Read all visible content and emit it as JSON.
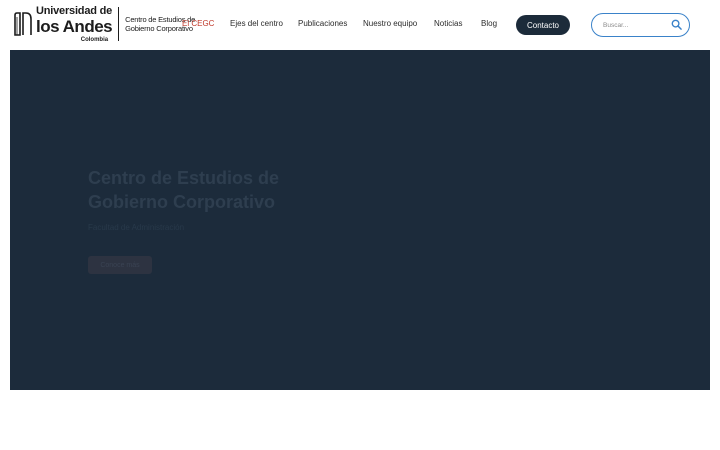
{
  "header": {
    "logo": {
      "line1": "Universidad de",
      "line2": "los Andes",
      "line3": "Colombia",
      "centro_line1": "Centro de Estudios de",
      "centro_line2": "Gobierno Corporativo"
    },
    "nav": [
      {
        "label": "El CEGC",
        "active": true
      },
      {
        "label": "Ejes del centro",
        "active": false
      },
      {
        "label": "Publicaciones",
        "active": false
      },
      {
        "label": "Nuestro equipo",
        "active": false
      },
      {
        "label": "Noticias",
        "active": false
      },
      {
        "label": "Blog",
        "active": false
      }
    ],
    "contact_label": "Contacto",
    "search_placeholder": "Buscar..."
  },
  "hero": {
    "title": "Centro de Estudios de Gobierno Corporativo",
    "subtitle": "Facultad de Administración",
    "button_label": "Conoce más"
  },
  "colors": {
    "accent": "#c0392b",
    "navy": "#1c2b3a",
    "search_border": "#3a82c9"
  }
}
